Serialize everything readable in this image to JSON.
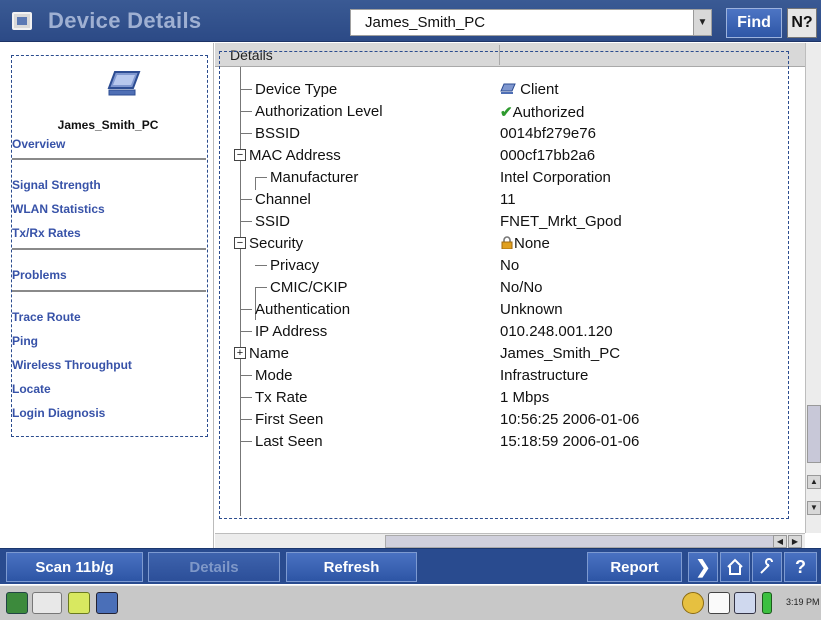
{
  "app": {
    "title": "Device Details",
    "selected_device": "James_Smith_PC",
    "find_label": "Find",
    "help_label": "N?"
  },
  "sidebar": {
    "device_name": "James_Smith_PC",
    "items": [
      {
        "label": "Overview"
      },
      {
        "label": "Signal Strength"
      },
      {
        "label": "WLAN Statistics"
      },
      {
        "label": "Tx/Rx Rates"
      },
      {
        "label": "Problems"
      },
      {
        "label": "Trace Route"
      },
      {
        "label": "Ping"
      },
      {
        "label": "Wireless Throughput"
      },
      {
        "label": "Locate"
      },
      {
        "label": "Login Diagnosis"
      }
    ]
  },
  "details": {
    "header": "Details",
    "rows": [
      {
        "label": "Device Type",
        "value": "Client"
      },
      {
        "label": "Authorization Level",
        "value": "Authorized"
      },
      {
        "label": "BSSID",
        "value": "0014bf279e76"
      },
      {
        "label": "MAC Address",
        "value": "000cf17bb2a6"
      },
      {
        "label": "Manufacturer",
        "value": "Intel Corporation"
      },
      {
        "label": "Channel",
        "value": "11"
      },
      {
        "label": "SSID",
        "value": "FNET_Mrkt_Gpod"
      },
      {
        "label": "Security",
        "value": "None"
      },
      {
        "label": "Privacy",
        "value": "No"
      },
      {
        "label": "CMIC/CKIP",
        "value": "No/No"
      },
      {
        "label": "Authentication",
        "value": "Unknown"
      },
      {
        "label": "IP Address",
        "value": "010.248.001.120"
      },
      {
        "label": "Name",
        "value": "James_Smith_PC"
      },
      {
        "label": "Mode",
        "value": "Infrastructure"
      },
      {
        "label": "Tx Rate",
        "value": "1 Mbps"
      },
      {
        "label": "First Seen",
        "value": "10:56:25 2006-01-06"
      },
      {
        "label": "Last Seen",
        "value": "15:18:59 2006-01-06"
      }
    ]
  },
  "toolbar": {
    "scan_label": "Scan 11b/g",
    "details_label": "Details",
    "refresh_label": "Refresh",
    "report_label": "Report"
  },
  "taskbar": {
    "clock": "3:19 PM"
  },
  "colors": {
    "accent": "#2d55a5",
    "link": "#3752a8",
    "authorized_check": "#2e9a2e",
    "selection_box": "#2b4c8e"
  }
}
